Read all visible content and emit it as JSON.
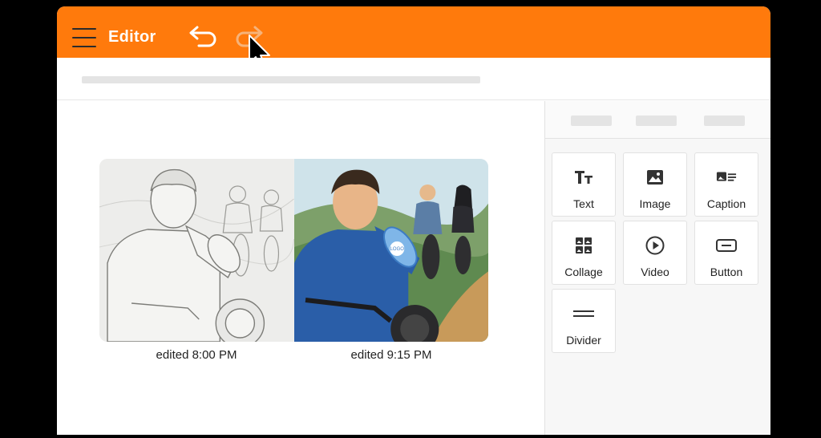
{
  "app": {
    "title": "Editor"
  },
  "toolbar": {
    "menu_icon": "hamburger-menu-icon",
    "undo_icon": "undo-arrow-icon",
    "redo_icon": "redo-arrow-icon"
  },
  "canvas": {
    "comparison": {
      "left": {
        "caption": "edited 8:00 PM",
        "style": "pencil-sketch"
      },
      "right": {
        "caption": "edited 9:15 PM",
        "style": "color-illustration",
        "bottle_label": "LOGO"
      }
    }
  },
  "sidebar": {
    "blocks": [
      {
        "label": "Text",
        "icon": "text-size-icon"
      },
      {
        "label": "Image",
        "icon": "image-icon"
      },
      {
        "label": "Caption",
        "icon": "caption-icon"
      },
      {
        "label": "Collage",
        "icon": "collage-icon"
      },
      {
        "label": "Video",
        "icon": "play-circle-icon"
      },
      {
        "label": "Button",
        "icon": "button-icon"
      },
      {
        "label": "Divider",
        "icon": "divider-icon"
      }
    ]
  },
  "colors": {
    "accent": "#ff7a0c",
    "background": "#000000",
    "panel": "#f7f7f7"
  }
}
